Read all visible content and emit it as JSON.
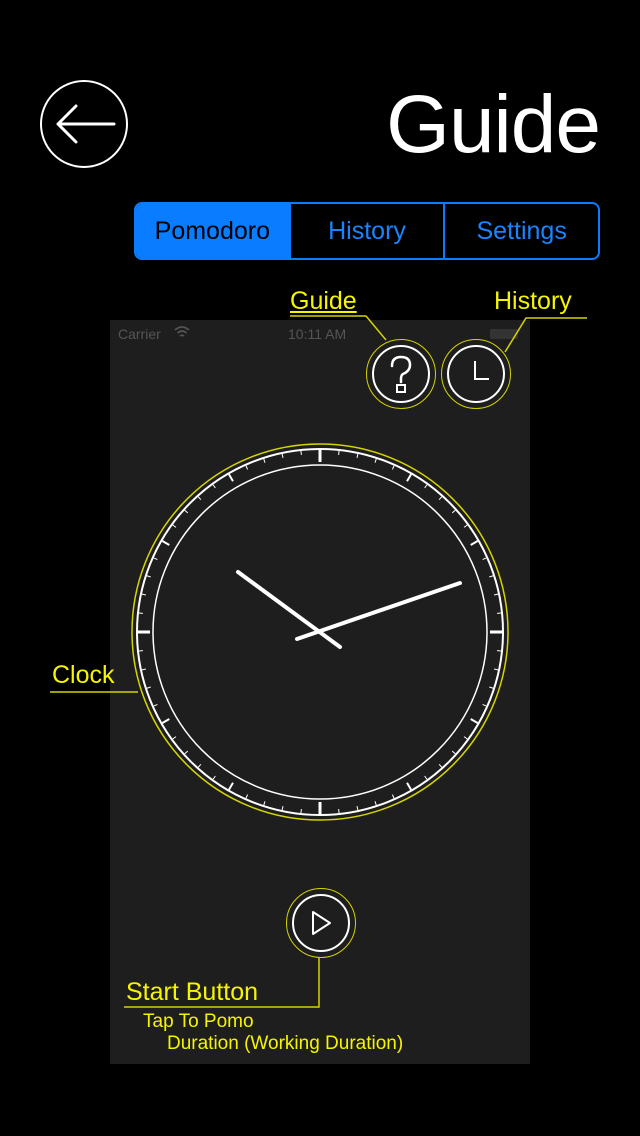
{
  "header": {
    "title": "Guide",
    "back_icon": "arrow-left-icon"
  },
  "tabs": [
    {
      "label": "Pomodoro",
      "active": true
    },
    {
      "label": "History",
      "active": false
    },
    {
      "label": "Settings",
      "active": false
    }
  ],
  "preview": {
    "status_carrier": "Carrier",
    "status_time": "10:11 AM",
    "guide_icon": "question-mark-icon",
    "history_icon": "clock-icon",
    "start_icon": "play-icon"
  },
  "annotations": {
    "guide": "Guide",
    "history": "History",
    "clock": "Clock",
    "start_button": "Start Button",
    "start_note_1": "Tap To Pomo",
    "start_note_2": "Duration (Working Duration)"
  },
  "colors": {
    "accent": "#0a7cff",
    "annotation": "#f5f500",
    "background": "#000000",
    "preview_bg": "#1e1e1e"
  }
}
